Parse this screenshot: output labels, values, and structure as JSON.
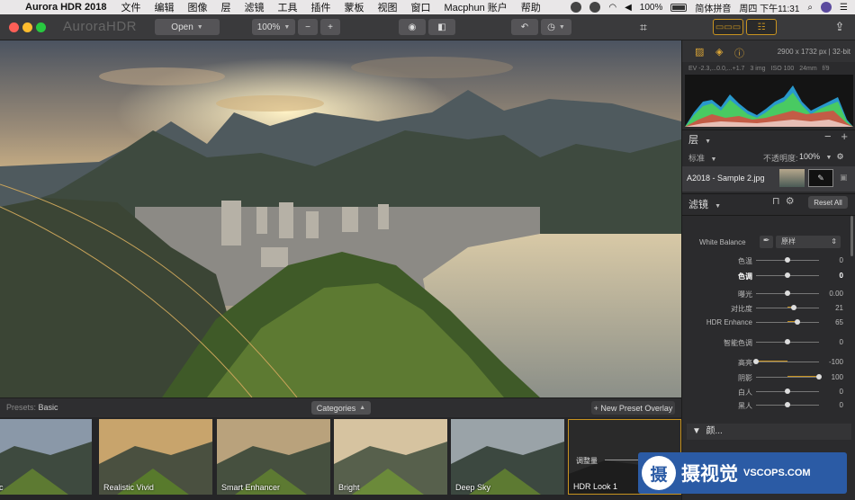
{
  "menubar": {
    "app_name": "Aurora HDR 2018",
    "menus": [
      "文件",
      "编辑",
      "图像",
      "层",
      "滤镜",
      "工具",
      "插件",
      "蒙板",
      "视图",
      "窗口",
      "Macphun 账户",
      "帮助"
    ],
    "battery": "100%",
    "input_method": "简体拼音",
    "clock": "周四 下午11:31"
  },
  "toolbar": {
    "brand": "AuroraHDR",
    "open_label": "Open",
    "zoom_label": "100%",
    "zoom_out": "−",
    "zoom_in": "+"
  },
  "presets": {
    "label": "Presets:",
    "value": "Basic",
    "categories_label": "Categories",
    "new_overlay_label": "+ New Preset Overlay",
    "items": [
      {
        "label": "alistic"
      },
      {
        "label": "Realistic Vivid"
      },
      {
        "label": "Smart Enhancer"
      },
      {
        "label": "Bright"
      },
      {
        "label": "Deep Sky"
      },
      {
        "label": "HDR Look 1"
      }
    ],
    "overlay_text": "调整量"
  },
  "info": {
    "image_size": "2900 x 1732 px",
    "bit_depth": "32-bit",
    "meta": [
      "EV -2.3,...0.0,...+1.7",
      "3 img",
      "ISO 100",
      "24mm",
      "f/9"
    ]
  },
  "layers": {
    "title": "层",
    "blend_mode": "标准",
    "opacity_label": "不透明度:",
    "opacity_value": "100%",
    "layer_name": "A2018 - Sample 2.jpg"
  },
  "filters": {
    "title": "滤镜",
    "reset_label": "Reset All",
    "white_balance_label": "White Balance",
    "white_balance_value": "原样",
    "sliders": [
      {
        "label": "色温",
        "value": "0",
        "level": 0.5,
        "bold": false
      },
      {
        "label": "色调",
        "value": "0",
        "level": 0.5,
        "bold": true
      },
      {
        "label": "曝光",
        "value": "0.00",
        "level": 0.5,
        "bold": false
      },
      {
        "label": "对比度",
        "value": "21",
        "level": 0.6,
        "bold": false
      },
      {
        "label": "HDR Enhance",
        "value": "65",
        "level": 0.65,
        "bold": false
      },
      {
        "label": "智能色调",
        "value": "0",
        "level": 0.5,
        "bold": false
      },
      {
        "label": "高亮",
        "value": "-100",
        "level": 0.0,
        "bold": false
      },
      {
        "label": "阴影",
        "value": "100",
        "level": 1.0,
        "bold": false
      },
      {
        "label": "白人",
        "value": "0",
        "level": 0.5,
        "bold": false
      },
      {
        "label": "黑人",
        "value": "0",
        "level": 0.5,
        "bold": false
      }
    ],
    "next_section": "颜..."
  },
  "watermark": {
    "logo_char": "摄",
    "name": "摄视觉",
    "url": "VSCOPS.COM"
  },
  "colors": {
    "accent": "#c89320",
    "panel": "#2b2b2d",
    "toolbar": "#3a3a3c"
  }
}
